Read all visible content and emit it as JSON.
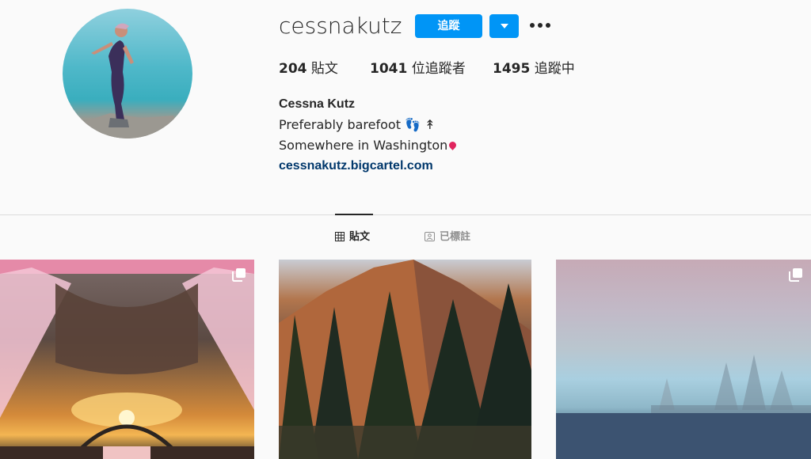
{
  "profile": {
    "username": "cessnakutz",
    "follow_label": "追蹤",
    "full_name": "Cessna Kutz",
    "bio_line1": "Preferably barefoot 👣 ↟",
    "bio_line2": "Somewhere in Washington",
    "website": "cessnakutz.bigcartel.com"
  },
  "stats": {
    "posts_count": "204",
    "posts_label": "貼文",
    "followers_count": "1041",
    "followers_label": "位追蹤者",
    "following_count": "1495",
    "following_label": "追蹤中"
  },
  "tabs": [
    {
      "label": "貼文",
      "active": true,
      "icon": "grid-icon"
    },
    {
      "label": "已標註",
      "active": false,
      "icon": "tagged-person-icon"
    }
  ],
  "posts": [
    {
      "alt": "pink-tent-sunset",
      "multi": true
    },
    {
      "alt": "mountain-pine-trees",
      "multi": false
    },
    {
      "alt": "rainbow-lake",
      "multi": true
    }
  ],
  "colors": {
    "accent": "#0095f6",
    "link": "#00376b",
    "text": "#262626",
    "muted": "#8e8e8e",
    "background": "#fafafa"
  }
}
